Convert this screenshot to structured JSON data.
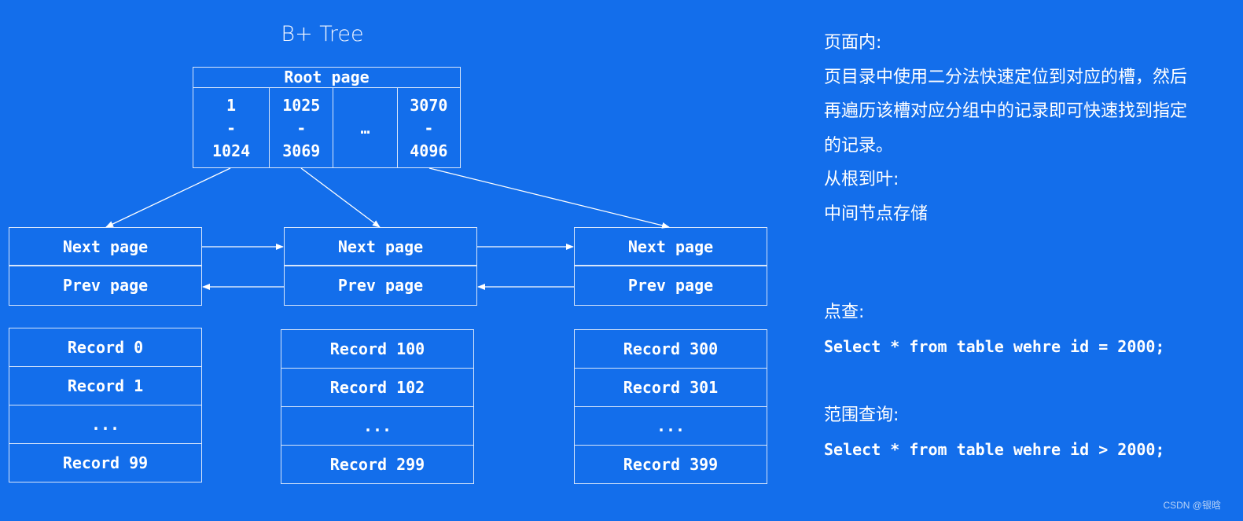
{
  "diagram": {
    "title": "B+ Tree",
    "root": {
      "label": "Root page",
      "cells": [
        {
          "from": "1",
          "sep": "-",
          "to": "1024"
        },
        {
          "from": "1025",
          "sep": "-",
          "to": "3069"
        },
        {
          "ellipsis": "…"
        },
        {
          "from": "3070",
          "sep": "-",
          "to": "4096"
        }
      ]
    },
    "leaves": [
      {
        "next": "Next page",
        "prev": "Prev page",
        "records": [
          "Record 0",
          "Record 1",
          "...",
          "Record 99"
        ]
      },
      {
        "next": "Next page",
        "prev": "Prev page",
        "records": [
          "Record 100",
          "Record 102",
          "...",
          "Record 299"
        ]
      },
      {
        "next": "Next page",
        "prev": "Prev page",
        "records": [
          "Record 300",
          "Record 301",
          "...",
          "Record 399"
        ]
      }
    ]
  },
  "notes": {
    "in_page_heading": "页面内:",
    "in_page_lines": [
      "页目录中使用二分法快速定位到对应的槽，然后",
      "再遍历该槽对应分组中的记录即可快速找到指定",
      "的记录。"
    ],
    "root_to_leaf_heading": "从根到叶:",
    "root_to_leaf_text": "中间节点存储",
    "point_query_heading": "点查:",
    "point_query_sql": "Select * from table wehre id = 2000;",
    "range_query_heading": "范围查询:",
    "range_query_sql": "Select * from table wehre id > 2000;"
  },
  "credit": "CSDN @银晗",
  "colors": {
    "background": "#136eeb",
    "line": "#d8e6fb",
    "text": "#ffffff"
  }
}
